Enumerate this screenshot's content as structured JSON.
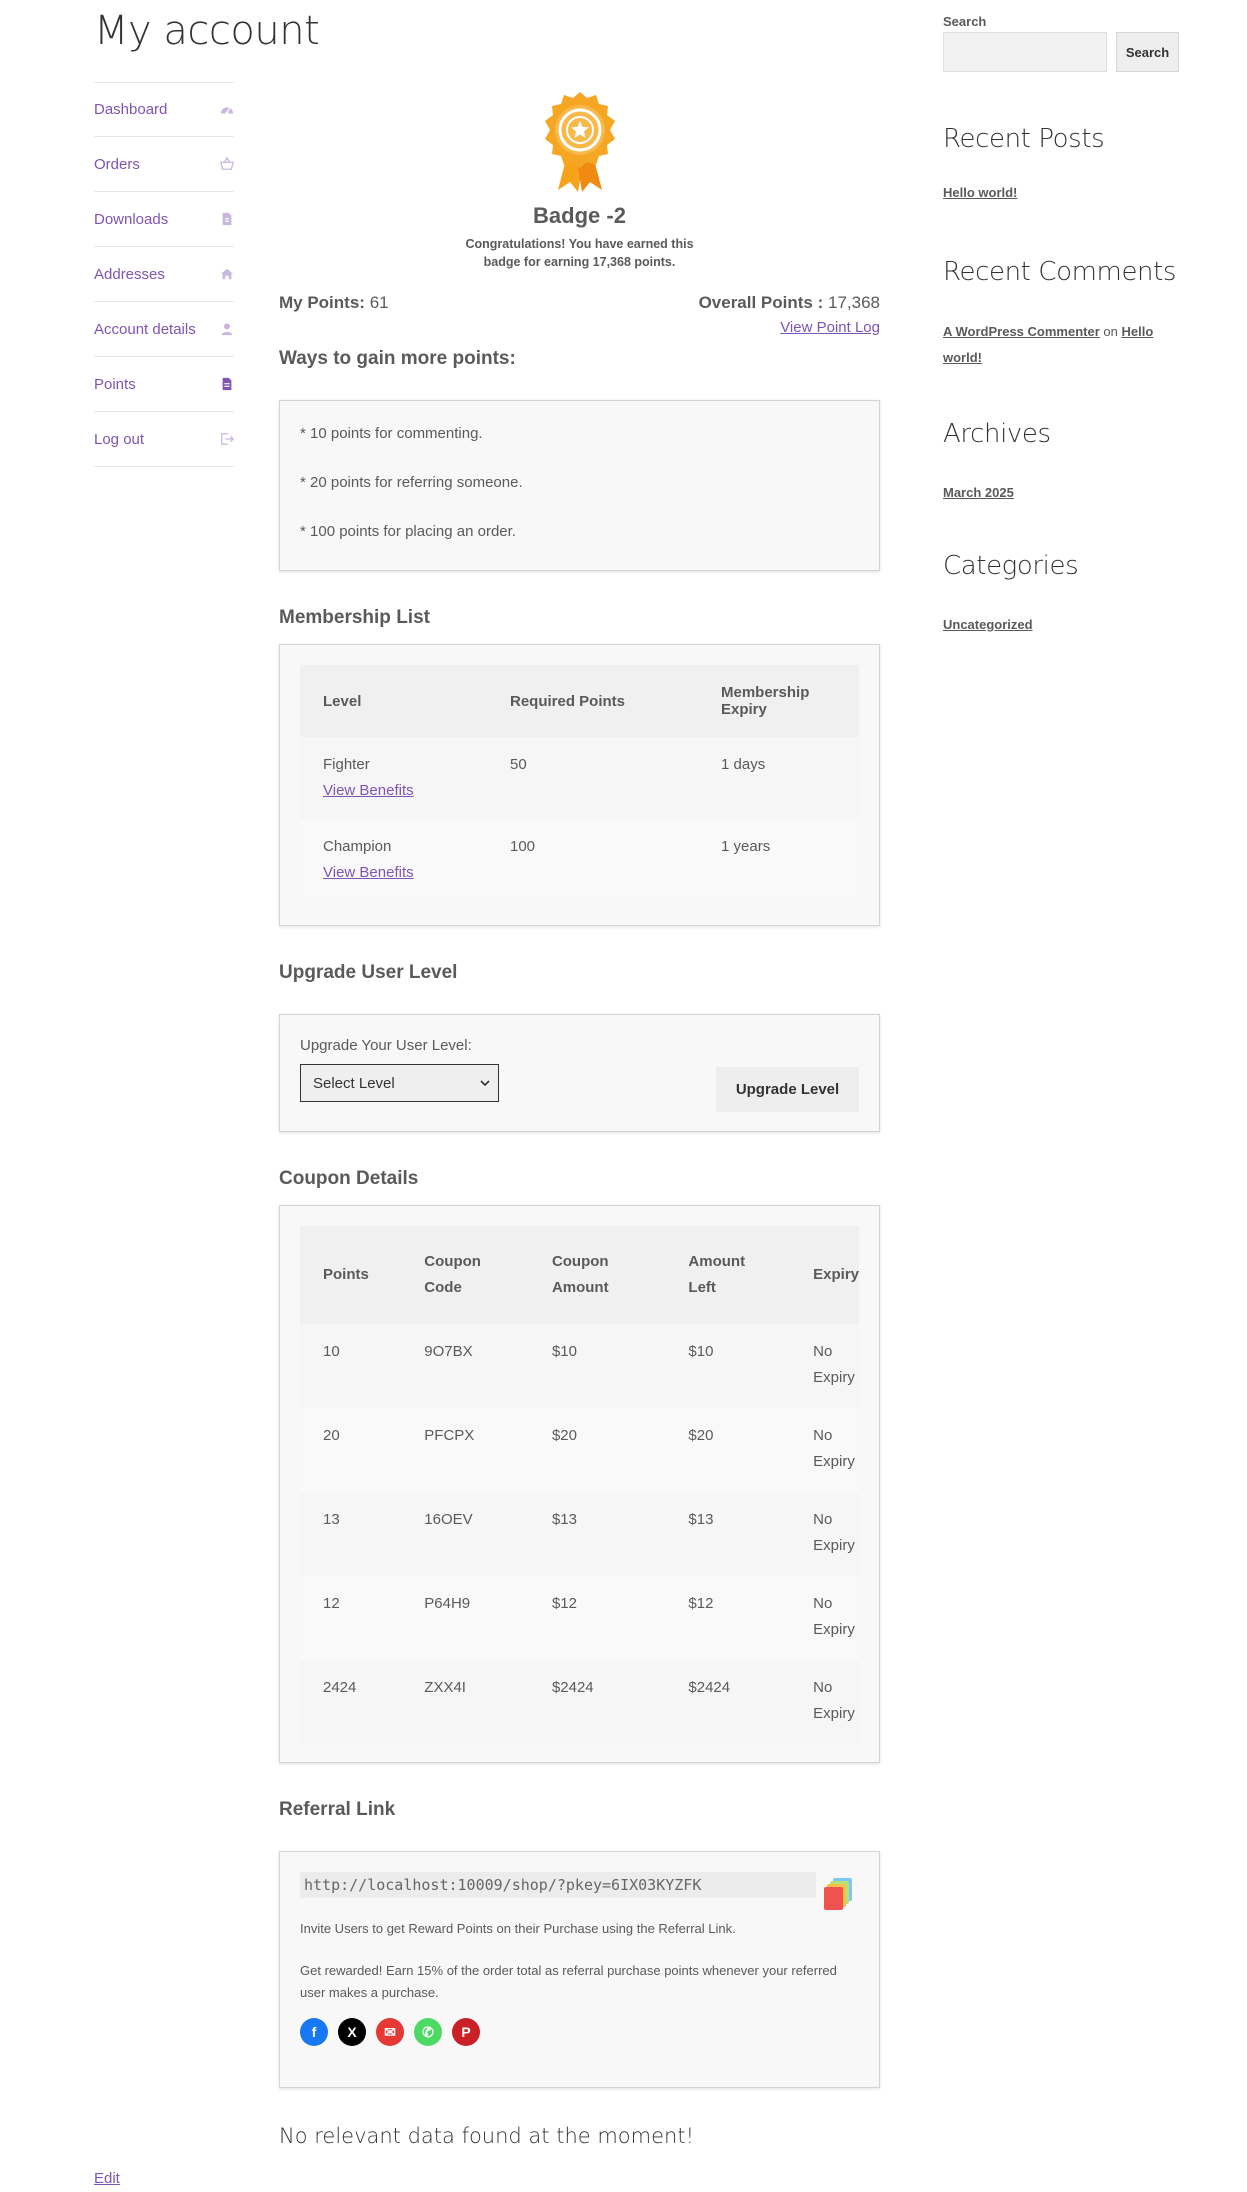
{
  "page": {
    "title": "My account",
    "edit_label": "Edit"
  },
  "nav": [
    {
      "label": "Dashboard",
      "icon": "dashboard-icon"
    },
    {
      "label": "Orders",
      "icon": "basket-icon"
    },
    {
      "label": "Downloads",
      "icon": "file-icon"
    },
    {
      "label": "Addresses",
      "icon": "home-icon"
    },
    {
      "label": "Account details",
      "icon": "user-icon"
    },
    {
      "label": "Points",
      "icon": "file-text-icon"
    },
    {
      "label": "Log out",
      "icon": "logout-icon"
    }
  ],
  "badge": {
    "title": "Badge -2",
    "message": "Congratulations! You have earned this badge for earning 17,368 points."
  },
  "points": {
    "my_label": "My Points:",
    "my_value": "61",
    "overall_label": "Overall Points :",
    "overall_value": "17,368",
    "log_link": "View Point Log"
  },
  "ways": {
    "title": "Ways to gain more points:",
    "items": [
      "* 10 points for commenting.",
      "* 20 points for referring someone.",
      "* 100 points for placing an order."
    ]
  },
  "membership": {
    "title": "Membership List",
    "headers": [
      "Level",
      "Required Points",
      "Membership Expiry"
    ],
    "rows": [
      {
        "level": "Fighter",
        "link": "View Benefits",
        "points": "50",
        "expiry": "1 days"
      },
      {
        "level": "Champion",
        "link": "View Benefits",
        "points": "100",
        "expiry": "1 years"
      }
    ]
  },
  "upgrade": {
    "title": "Upgrade User Level",
    "label": "Upgrade Your User Level:",
    "select_value": "Select Level",
    "button": "Upgrade Level"
  },
  "coupons": {
    "title": "Coupon Details",
    "headers": [
      [
        "Points"
      ],
      [
        "Coupon",
        "Code"
      ],
      [
        "Coupon",
        "Amount"
      ],
      [
        "Amount",
        "Left"
      ],
      [
        "Expiry"
      ]
    ],
    "rows": [
      {
        "points": "10",
        "code": "9O7BX",
        "amount": "$10",
        "left": "$10",
        "expiry": [
          "No",
          "Expiry"
        ]
      },
      {
        "points": "20",
        "code": "PFCPX",
        "amount": "$20",
        "left": "$20",
        "expiry": [
          "No",
          "Expiry"
        ]
      },
      {
        "points": "13",
        "code": "16OEV",
        "amount": "$13",
        "left": "$13",
        "expiry": [
          "No",
          "Expiry"
        ]
      },
      {
        "points": "12",
        "code": "P64H9",
        "amount": "$12",
        "left": "$12",
        "expiry": [
          "No",
          "Expiry"
        ]
      },
      {
        "points": "2424",
        "code": "ZXX4I",
        "amount": "$2424",
        "left": "$2424",
        "expiry": [
          "No",
          "Expiry"
        ]
      }
    ]
  },
  "referral": {
    "title": "Referral Link",
    "url": "http://localhost:10009/shop/?pkey=6IX03KYZFK",
    "invite_text": "Invite Users to get Reward Points on their Purchase using the Referral Link.",
    "reward_text": "Get rewarded! Earn 15% of the order total as referral purchase points whenever your referred user makes a purchase.",
    "social": [
      {
        "icon": "facebook-icon",
        "color": "#1877f2",
        "glyph": "f"
      },
      {
        "icon": "x-twitter-icon",
        "color": "#000000",
        "glyph": "X"
      },
      {
        "icon": "email-icon",
        "color": "#e53935",
        "glyph": "✉"
      },
      {
        "icon": "whatsapp-icon",
        "color": "#4cd964",
        "glyph": "✆"
      },
      {
        "icon": "pinterest-icon",
        "color": "#cb2027",
        "glyph": "P"
      }
    ]
  },
  "no_data": "No relevant data found at the moment!",
  "sidebar": {
    "search_label": "Search",
    "search_button": "Search",
    "recent_posts_title": "Recent Posts",
    "recent_posts": [
      "Hello world!"
    ],
    "recent_comments_title": "Recent Comments",
    "comment_author": "A WordPress Commenter",
    "comment_on": "on",
    "comment_post": "Hello world!",
    "archives_title": "Archives",
    "archives": [
      "March 2025"
    ],
    "categories_title": "Categories",
    "categories": [
      "Uncategorized"
    ]
  },
  "colors": {
    "accent": "#7f54b3",
    "text": "#5a5a5a",
    "badge_orange": "#f5a623"
  }
}
